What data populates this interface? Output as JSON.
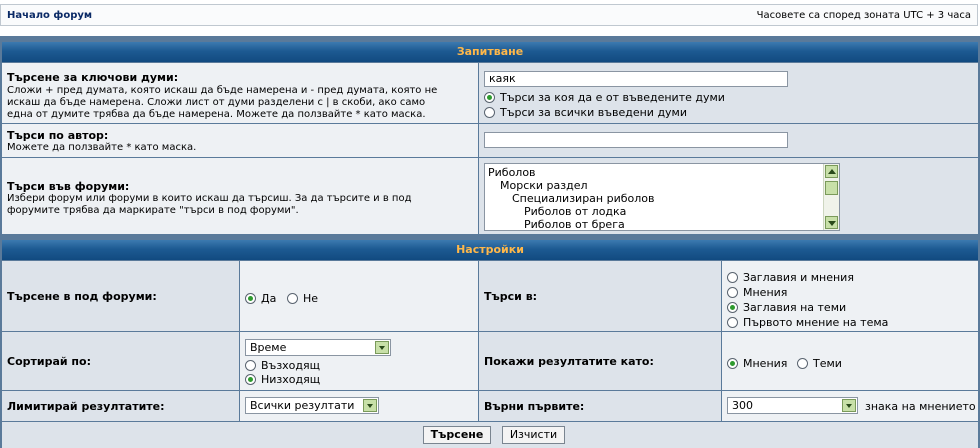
{
  "nav": {
    "home_link": "Начало форум",
    "timezone": "Часовете са според зоната UTC + 3 часа"
  },
  "query": {
    "header": "Запитване",
    "keywords": {
      "label": "Търсене за ключови думи:",
      "hint_lines": [
        "Сложи + пред думата, която искаш да бъде намерена и - пред думата, която не",
        "искаш да бъде намерена. Сложи лист от думи разделени с | в скоби, ако само",
        "една от думите трябва да бъде намерена. Можете да ползвайте * като маска."
      ],
      "value": "каяк",
      "options": [
        {
          "label": "Търси за коя да е от въведените думи",
          "selected": true
        },
        {
          "label": "Търси за всички въведени думи",
          "selected": false
        }
      ]
    },
    "author": {
      "label": "Търси по автор:",
      "hint": "Можете да ползвайте * като маска.",
      "value": ""
    },
    "forums": {
      "label": "Търси във форуми:",
      "hint_lines": [
        "Избери форум или форуми в които искаш да търсиш. За да търсите и в под",
        "форумите трябва да маркирате \"търси в под форуми\"."
      ],
      "items": [
        "Риболов",
        "Морски раздел",
        "Специализиран риболов",
        "Риболов от лодка",
        "Риболов от брега"
      ]
    }
  },
  "settings": {
    "header": "Настройки",
    "subforums": {
      "label": "Търсене в под форуми:",
      "options": [
        {
          "label": "Да",
          "selected": true
        },
        {
          "label": "Не",
          "selected": false
        }
      ]
    },
    "search_in": {
      "label": "Търси в:",
      "options": [
        {
          "label": "Заглавия и мнения",
          "selected": false
        },
        {
          "label": "Мнения",
          "selected": false
        },
        {
          "label": "Заглавия на теми",
          "selected": true
        },
        {
          "label": "Първото мнение на тема",
          "selected": false
        }
      ]
    },
    "sort": {
      "label": "Сортирай по:",
      "value": "Време",
      "options": [
        {
          "label": "Възходящ",
          "selected": false
        },
        {
          "label": "Низходящ",
          "selected": true
        }
      ]
    },
    "show_as": {
      "label": "Покажи резултатите като:",
      "options": [
        {
          "label": "Мнения",
          "selected": true
        },
        {
          "label": "Теми",
          "selected": false
        }
      ]
    },
    "limit": {
      "label": "Лимитирай резултатите:",
      "value": "Всички резултати"
    },
    "return_first": {
      "label": "Върни първите:",
      "value": "300",
      "suffix": "знака на мнението"
    }
  },
  "buttons": {
    "search": "Търсене",
    "reset": "Изчисти"
  },
  "colors": {
    "header_text": "#ffb84a",
    "header_bg": "#1d5a92",
    "radio_on": "#2e9a2e"
  }
}
